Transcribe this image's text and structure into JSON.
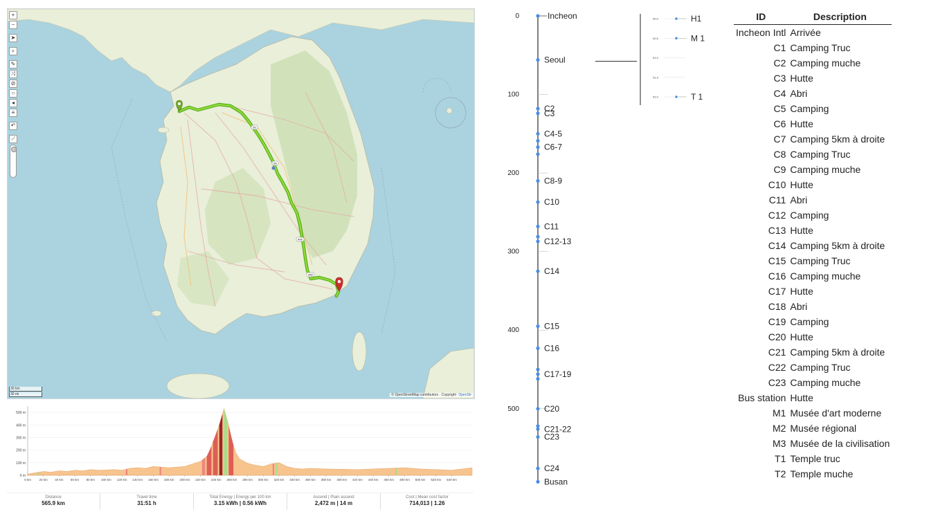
{
  "map": {
    "toolbar": [
      {
        "name": "zoom-in-button",
        "glyph": "+"
      },
      {
        "name": "zoom-out-button",
        "glyph": "−"
      },
      {
        "name": "gap"
      },
      {
        "name": "locate-button",
        "glyph": "➤"
      },
      {
        "name": "gap"
      },
      {
        "name": "search-button",
        "glyph": "⌕"
      },
      {
        "name": "gap"
      },
      {
        "name": "draw-route-button",
        "glyph": "✎"
      },
      {
        "name": "reverse-route-button",
        "glyph": "⤨"
      },
      {
        "name": "delete-route-button",
        "glyph": "⊘"
      },
      {
        "name": "draw-circle-button",
        "glyph": "○"
      },
      {
        "name": "sound-button",
        "glyph": "◂"
      },
      {
        "name": "layers-button",
        "glyph": "≡"
      },
      {
        "name": "gap"
      },
      {
        "name": "undo-button",
        "glyph": "↶"
      },
      {
        "name": "gap"
      },
      {
        "name": "elevation-toggle-button",
        "glyph": "⟋"
      }
    ],
    "scale_km": "30 km",
    "scale_mi": "30 mi",
    "attribution": "© OpenStreetMap contributors · Copyright",
    "attribution_right": "OpenStr",
    "colors": {
      "water": "#aad3df",
      "land": "#e9efd9",
      "forest": "#cddfb5",
      "route": "#7ccd21",
      "route_edge": "#4aa80e",
      "start_marker": "#73a82c",
      "end_marker": "#c9302c"
    },
    "road_labels": [
      "50",
      "60",
      "400",
      "450"
    ]
  },
  "elevation": {
    "y_ticks": [
      "500 m",
      "400 m",
      "300 m",
      "200 m",
      "100 m",
      "0 m"
    ],
    "x_ticks": [
      "0 km",
      "20 km",
      "40 km",
      "60 km",
      "80 km",
      "100 km",
      "120 km",
      "140 km",
      "160 km",
      "180 km",
      "200 km",
      "220 km",
      "240 km",
      "260 km",
      "280 km",
      "300 km",
      "320 km",
      "340 km",
      "360 km",
      "380 km",
      "400 km",
      "420 km",
      "440 km",
      "460 km",
      "480 km",
      "500 km",
      "520 km",
      "540 km"
    ],
    "profile": [
      [
        0,
        10
      ],
      [
        10,
        20
      ],
      [
        20,
        30
      ],
      [
        30,
        25
      ],
      [
        40,
        35
      ],
      [
        50,
        30
      ],
      [
        60,
        40
      ],
      [
        70,
        35
      ],
      [
        80,
        45
      ],
      [
        90,
        40
      ],
      [
        100,
        42
      ],
      [
        110,
        45
      ],
      [
        120,
        40
      ],
      [
        130,
        55
      ],
      [
        140,
        60
      ],
      [
        150,
        55
      ],
      [
        160,
        70
      ],
      [
        170,
        65
      ],
      [
        180,
        60
      ],
      [
        190,
        65
      ],
      [
        200,
        70
      ],
      [
        210,
        90
      ],
      [
        220,
        110
      ],
      [
        230,
        160
      ],
      [
        235,
        250
      ],
      [
        240,
        330
      ],
      [
        245,
        420
      ],
      [
        250,
        530
      ],
      [
        255,
        420
      ],
      [
        260,
        280
      ],
      [
        265,
        180
      ],
      [
        270,
        130
      ],
      [
        280,
        95
      ],
      [
        290,
        80
      ],
      [
        300,
        70
      ],
      [
        310,
        90
      ],
      [
        320,
        100
      ],
      [
        330,
        70
      ],
      [
        340,
        55
      ],
      [
        350,
        50
      ],
      [
        360,
        55
      ],
      [
        380,
        50
      ],
      [
        400,
        48
      ],
      [
        420,
        45
      ],
      [
        440,
        50
      ],
      [
        460,
        55
      ],
      [
        480,
        60
      ],
      [
        500,
        50
      ],
      [
        520,
        45
      ],
      [
        540,
        40
      ],
      [
        560,
        55
      ],
      [
        566,
        60
      ]
    ],
    "colors": {
      "base": "#f8c48e",
      "steep_up": "#d9534f",
      "steep_down": "#f08080",
      "flat": "#9de08a",
      "peak": "#8b1a1a"
    }
  },
  "stats": [
    {
      "label": "Distance",
      "value": "565.9 km"
    },
    {
      "label": "Travel time",
      "value": "31:51 h"
    },
    {
      "label": "Total Energy | Energy per 100 km",
      "value": "3.15 kWh | 0.56 kWh"
    },
    {
      "label": "Ascend | Plain ascend",
      "value": "2,472 m | 14 m"
    },
    {
      "label": "Cost | Mean cost factor",
      "value": "714,013 | 1.26"
    }
  ],
  "timeline": {
    "y_ticks": [
      0,
      100,
      200,
      300,
      400,
      500
    ],
    "y_max": 590,
    "stops": [
      {
        "pos": 0,
        "label": "Incheon"
      },
      {
        "pos": 56,
        "label": "Seoul"
      },
      {
        "pos": 118,
        "label": "C2"
      },
      {
        "pos": 124,
        "label": "C3"
      },
      {
        "pos": 150,
        "label": "C4-5"
      },
      {
        "pos": 159
      },
      {
        "pos": 167,
        "label": "C6-7"
      },
      {
        "pos": 176
      },
      {
        "pos": 210,
        "label": "C8-9"
      },
      {
        "pos": 237,
        "label": "C10"
      },
      {
        "pos": 268,
        "label": "C11"
      },
      {
        "pos": 281
      },
      {
        "pos": 287,
        "label": "C12-13"
      },
      {
        "pos": 325,
        "label": "C14"
      },
      {
        "pos": 395,
        "label": "C15"
      },
      {
        "pos": 423,
        "label": "C16"
      },
      {
        "pos": 450
      },
      {
        "pos": 456,
        "label": "C17-19"
      },
      {
        "pos": 462
      },
      {
        "pos": 500,
        "label": "C20"
      },
      {
        "pos": 522
      },
      {
        "pos": 526,
        "label": "C21-22"
      },
      {
        "pos": 536,
        "label": "C23"
      },
      {
        "pos": 576,
        "label": "C24"
      },
      {
        "pos": 593,
        "label": "Busan"
      }
    ]
  },
  "mini_chart": {
    "y_ticks": [
      "50.0",
      "50.5",
      "51.0",
      "51.5",
      "52.0"
    ],
    "points": [
      {
        "y": 50.0,
        "label": "H1"
      },
      {
        "y": 50.5,
        "label": "M 1"
      },
      {
        "y": 52.0,
        "label": "T 1"
      }
    ]
  },
  "table": {
    "headers": [
      "ID",
      "Description"
    ],
    "rows": [
      [
        "Incheon Intl",
        "Arrivée"
      ],
      [
        "C1",
        "Camping Truc"
      ],
      [
        "C2",
        "Camping muche"
      ],
      [
        "C3",
        "Hutte"
      ],
      [
        "C4",
        "Abri"
      ],
      [
        "C5",
        "Camping"
      ],
      [
        "C6",
        "Hutte"
      ],
      [
        "C7",
        "Camping 5km à droite"
      ],
      [
        "C8",
        "Camping Truc"
      ],
      [
        "C9",
        "Camping muche"
      ],
      [
        "C10",
        "Hutte"
      ],
      [
        "C11",
        "Abri"
      ],
      [
        "C12",
        "Camping"
      ],
      [
        "C13",
        "Hutte"
      ],
      [
        "C14",
        "Camping 5km à droite"
      ],
      [
        "C15",
        "Camping Truc"
      ],
      [
        "C16",
        "Camping muche"
      ],
      [
        "C17",
        "Hutte"
      ],
      [
        "C18",
        "Abri"
      ],
      [
        "C19",
        "Camping"
      ],
      [
        "C20",
        "Hutte"
      ],
      [
        "C21",
        "Camping 5km à droite"
      ],
      [
        "C22",
        "Camping Truc"
      ],
      [
        "C23",
        "Camping muche"
      ],
      [
        "Bus station",
        "Hutte"
      ],
      [
        "M1",
        "Musée d'art moderne"
      ],
      [
        "M2",
        "Musée régional"
      ],
      [
        "M3",
        "Musée de la civilisation"
      ],
      [
        "T1",
        "Temple truc"
      ],
      [
        "T2",
        "Temple muche"
      ]
    ]
  }
}
